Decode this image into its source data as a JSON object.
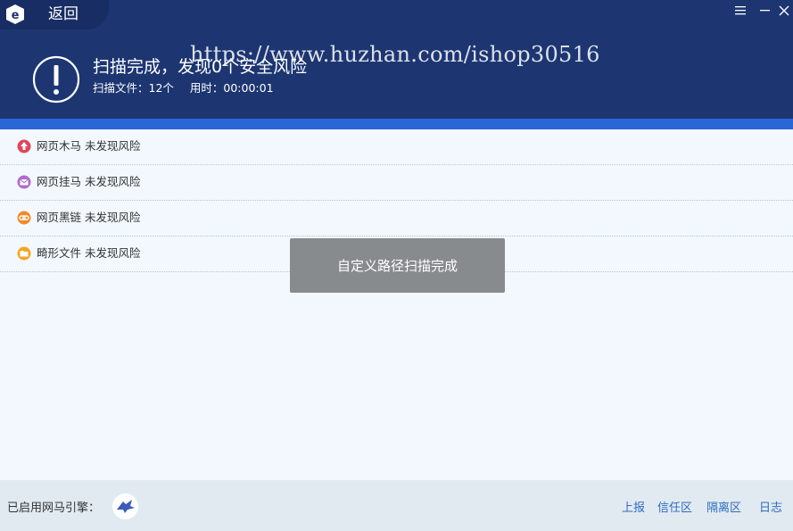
{
  "header": {
    "back_label": "返回",
    "scan_title": "扫描完成，发现0个安全风险",
    "files_scanned": "扫描文件：12个",
    "elapsed": "用时：00:00:01",
    "watermark": "https://www.huzhan.com/ishop30516"
  },
  "results": [
    {
      "label": "网页木马 未发现风险",
      "icon": "trojan-icon",
      "color": "#e0465a"
    },
    {
      "label": "网页挂马 未发现风险",
      "icon": "mail-icon",
      "color": "#b26ac9"
    },
    {
      "label": "网页黑链 未发现风险",
      "icon": "link-icon",
      "color": "#f08c2e"
    },
    {
      "label": "畸形文件 未发现风险",
      "icon": "folder-icon",
      "color": "#f5a623"
    }
  ],
  "toast": {
    "message": "自定义路径扫描完成"
  },
  "footer": {
    "engine_label": "已启用网马引擎：",
    "links": {
      "report": "上报",
      "trust": "信任区",
      "quarantine": "隔离区",
      "log": "日志"
    }
  },
  "colors": {
    "header_bg": "#1d3672",
    "accent_bar": "#2a66d6",
    "content_bg": "#f2f8fd",
    "footer_bg": "#e1eaf1",
    "link": "#2f6bc0"
  }
}
